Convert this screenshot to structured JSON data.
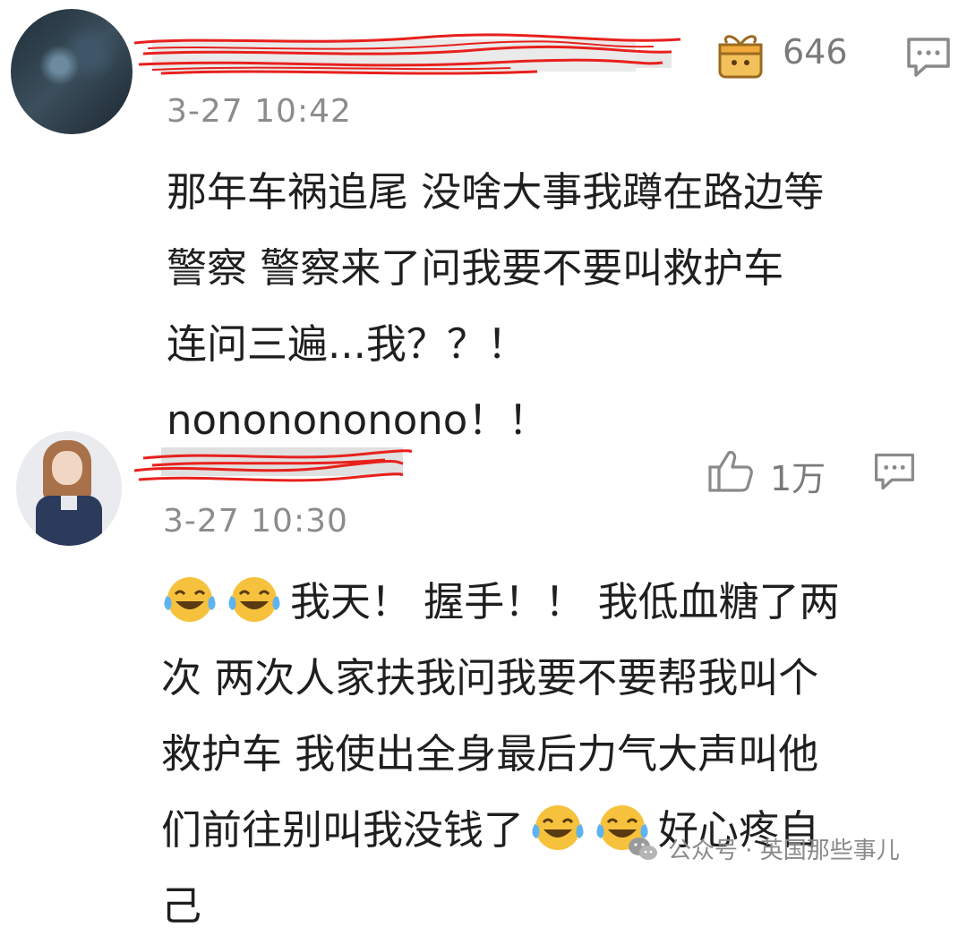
{
  "comments": [
    {
      "author": "redacted",
      "gift_count": "646",
      "timestamp": "3-27 10:42",
      "lines": [
        "那年车祸追尾 没啥大事我蹲在路边等",
        "警察 警察来了问我要不要叫救护车",
        "连问三遍...我？？！",
        "nononononono！！"
      ],
      "icons": [
        "gift-icon",
        "reply-icon"
      ]
    },
    {
      "author": "redacted",
      "like_count": "1万",
      "timestamp": "3-27 10:30",
      "line1_text": "我天！ 握手！！ 我低血糖了两",
      "lines_rest": [
        "次 两次人家扶我问我要不要帮我叫个",
        "救护车 我使出全身最后力气大声叫他"
      ],
      "line4_before": "们前往别叫我没钱了",
      "line4_after": "好心疼自",
      "line5": "己",
      "icons": [
        "like-icon",
        "reply-icon",
        "laughing-tears-emoji"
      ]
    }
  ],
  "watermark": {
    "text": "公众号 · 英国那些事儿",
    "icon": "wechat-icon"
  },
  "colors": {
    "redaction": "#e8201c",
    "meta_text": "#8c8c8c",
    "body_text": "#1f1f1f",
    "emoji_face": "#f6c23e"
  }
}
